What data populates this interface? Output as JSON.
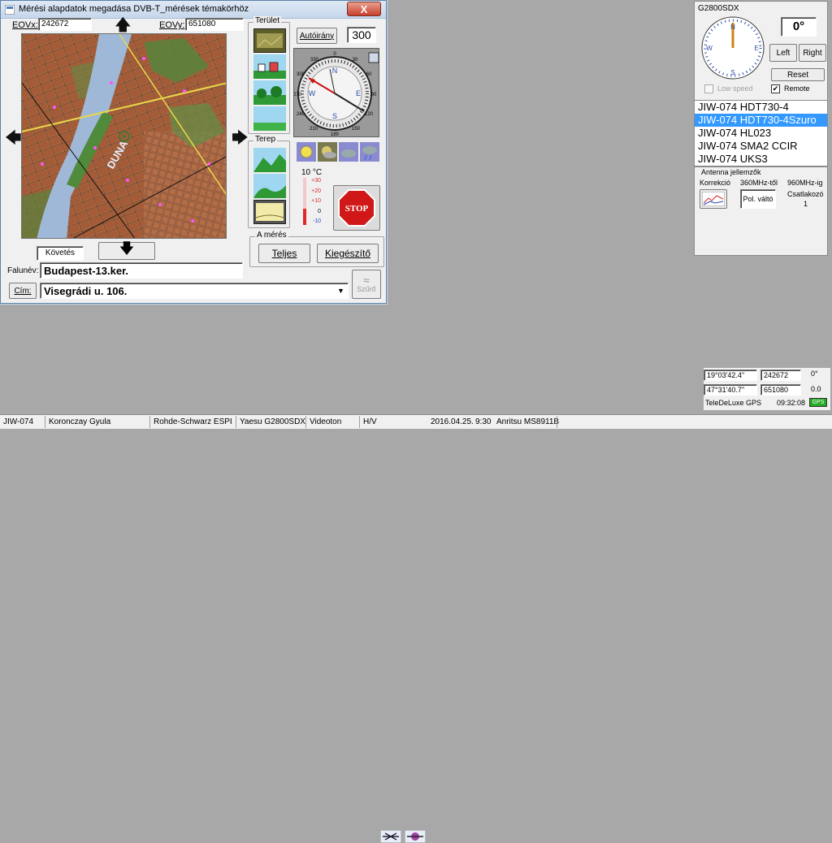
{
  "dialog": {
    "title": "Mérési alapdatok megadása DVB-T_mérések témakörhöz",
    "close_label": "X",
    "eovx_label": "EOVx:",
    "eovx_value": "242672",
    "eovy_label": "EOVy:",
    "eovy_value": "651080",
    "map_label": "DUNA",
    "follow_label": "Követés",
    "city_label": "Falunév:",
    "city_value": "Budapest-13.ker.",
    "address_label": "Cím:",
    "address_value": "Visegrádi u. 106.",
    "filter_label": "Szűrő",
    "area_group": "Terület",
    "terrain_group": "Terep",
    "autoiranyt_label": "Autóirány",
    "azimuth_value": "300",
    "compass_labels": {
      "n": "N",
      "e": "E",
      "s": "S",
      "w": "W",
      "t0": "0",
      "t30": "30",
      "t60": "60",
      "t90": "90",
      "t120": "120",
      "t150": "150",
      "t180": "180",
      "t210": "210",
      "t240": "240",
      "t270": "270",
      "t300": "300",
      "t330": "330"
    },
    "temp_label": "10 °C",
    "temp_scale": [
      "+30",
      "+20",
      "+10",
      "0",
      "-10"
    ],
    "stop_label": "STOP",
    "measurement_group": "A mérés",
    "full_button": "Teljes",
    "extra_button": "Kiegészítő"
  },
  "rotator": {
    "title": "G2800SDX",
    "angle": "0°",
    "left_button": "Left",
    "right_button": "Right",
    "reset_button": "Reset",
    "low_speed_label": "Low speed",
    "remote_label": "Remote",
    "remote_checked": true,
    "compass": {
      "n": "N",
      "e": "E",
      "s": "S",
      "w": "W"
    }
  },
  "antennas": {
    "items": [
      "JIW-074 HDT730-4",
      "JIW-074 HDT730-4Szuro",
      "JIW-074 HL023",
      "JIW-074 SMA2 CCIR",
      "JIW-074 UKS3"
    ],
    "selected_index": 1
  },
  "antenna_props": {
    "title": "Antenna jellemzők",
    "correction_label": "Korrekció",
    "from_label": "360MHz-től",
    "to_label": "960MHz-ig",
    "pol_label": "Pol. váltó",
    "connector_label": "Csatlakozó",
    "connector_value": "1"
  },
  "gps": {
    "lon": "19°03'42.4''",
    "eovx": "242672",
    "heading": "0°",
    "lat": "47°31'40.7''",
    "eovy": "651080",
    "speed": "0.0",
    "source": "TeleDeLuxe GPS",
    "time": "09:32:08",
    "badge": "GPS",
    "badge_color": "#22aa22"
  },
  "status": {
    "station": "JIW-074",
    "operator": "Koronczay Gyula",
    "receiver": "Rohde-Schwarz ESPI",
    "rotator": "Yaesu G2800SDX",
    "company": "Videoton",
    "polarity": "H/V",
    "date": "2016.04.25.",
    "time": "9:30",
    "analyzer": "Anritsu MS8911B"
  }
}
